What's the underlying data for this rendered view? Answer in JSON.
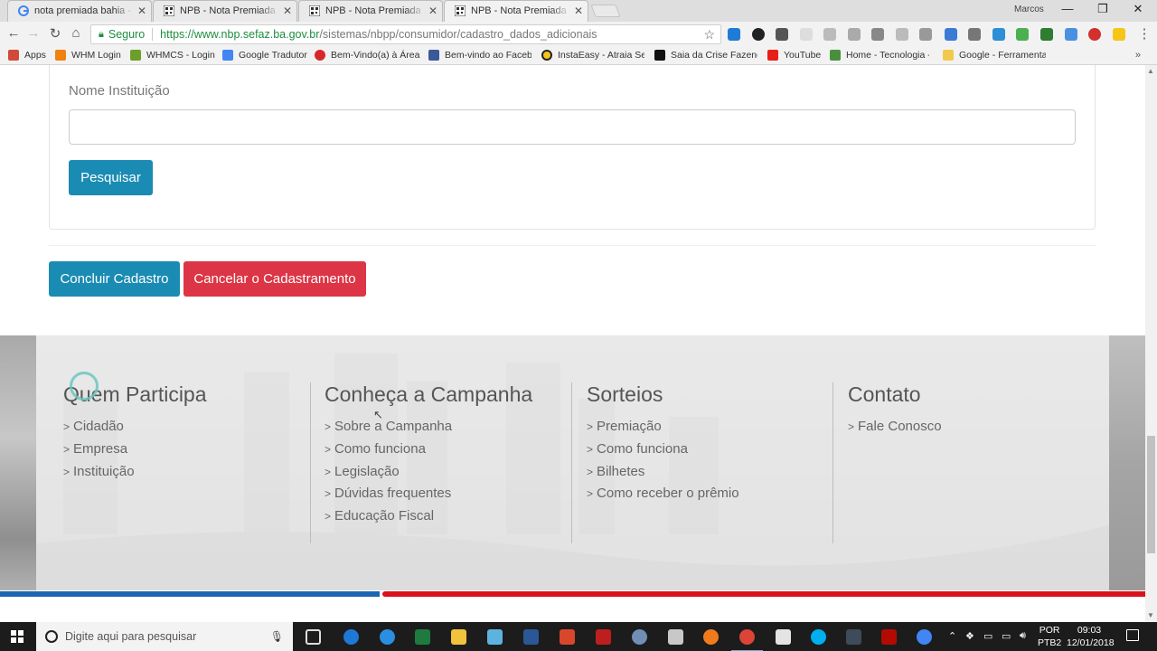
{
  "browser": {
    "tabs": [
      {
        "title": "nota premiada bahia - Pe",
        "favicon": "google-icon"
      },
      {
        "title": "NPB - Nota Premiada Bah",
        "favicon": "qr-icon"
      },
      {
        "title": "NPB - Nota Premiada Bah",
        "favicon": "qr-icon"
      },
      {
        "title": "NPB - Nota Premiada Bah",
        "favicon": "qr-icon"
      }
    ],
    "profile_name": "Marcos",
    "secure_label": "Seguro",
    "url_host": "https://www.nbp.sefaz.ba.gov.br",
    "url_path": "/sistemas/nbpp/consumidor/cadastro_dados_adicionais",
    "bookmarks": [
      {
        "label": "Apps",
        "color": "#d04a3a"
      },
      {
        "label": "WHM Login",
        "color": "#f0820f"
      },
      {
        "label": "WHMCS - Login",
        "color": "#6c9e2a"
      },
      {
        "label": "Google Tradutor",
        "color": "#4285f4"
      },
      {
        "label": "Bem-Vindo(a) à Área",
        "color": "#d62828"
      },
      {
        "label": "Bem-vindo ao Facebo",
        "color": "#3b5998"
      },
      {
        "label": "InstaEasy - Atraia Seg",
        "color": "#222222"
      },
      {
        "label": "Saia da Crise Fazendo",
        "color": "#111111"
      },
      {
        "label": "YouTube",
        "color": "#e62117"
      },
      {
        "label": "Home - Tecnologia -",
        "color": "#4a8f3c"
      },
      {
        "label": "Google - Ferramenta",
        "color": "#f2c94c"
      }
    ]
  },
  "form": {
    "institution_label": "Nome Instituição",
    "institution_value": "",
    "search_button": "Pesquisar",
    "finish_button": "Concluir Cadastro",
    "cancel_button": "Cancelar o Cadastramento"
  },
  "footer": {
    "columns": [
      {
        "heading": "Quem Participa",
        "links": [
          "Cidadão",
          "Empresa",
          "Instituição"
        ]
      },
      {
        "heading": "Conheça a Campanha",
        "links": [
          "Sobre a Campanha",
          "Como funciona",
          "Legislação",
          "Dúvidas frequentes",
          "Educação Fiscal"
        ]
      },
      {
        "heading": "Sorteios",
        "links": [
          "Premiação",
          "Como funciona",
          "Bilhetes",
          "Como receber o prêmio"
        ]
      },
      {
        "heading": "Contato",
        "links": [
          "Fale Conosco"
        ]
      }
    ]
  },
  "taskbar": {
    "search_placeholder": "Digite aqui para pesquisar",
    "language": "POR",
    "layout": "PTB2",
    "time": "09:03",
    "date": "12/01/2018"
  },
  "colors": {
    "primary_button": "#1a8bb3",
    "danger_button": "#dc3545",
    "stripe_blue": "#1b66b3",
    "stripe_red": "#d9121d"
  }
}
